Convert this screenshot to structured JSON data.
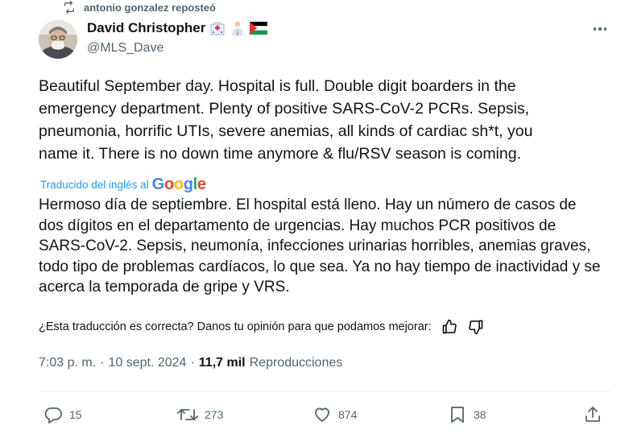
{
  "repost": {
    "label": "antonio gonzalez reposteó"
  },
  "author": {
    "name": "David Christopher",
    "handle": "@MLS_Dave"
  },
  "tweet": {
    "text": "Beautiful September day. Hospital is full. Double digit boarders in the\nemergency department. Plenty of positive SARS-CoV-2 PCRs. Sepsis,\npneumonia, horrific UTIs, severe anemias, all kinds of cardiac sh*t, you\nname it. There is no down time anymore & flu/RSV season is coming.",
    "translated_by": "Traducido del inglés al",
    "translator_brand": "Google",
    "translation": "Hermoso día de septiembre. El hospital está lleno. Hay un número de casos de dos dígitos en el departamento de urgencias. Hay muchos PCR positivos de SARS-CoV-2. Sepsis, neumonía, infecciones urinarias horribles, anemias graves, todo tipo de problemas cardíacos, lo que sea. Ya no hay tiempo de inactividad y se acerca la temporada de gripe y VRS.",
    "feedback_prompt": "¿Esta traducción es correcta? Danos tu opinión para que podamos mejorar:",
    "time": "7:03 p. m.",
    "separator": "·",
    "date": "10 sept. 2024",
    "views_count": "11,7 mil",
    "views_label": "Reproducciones"
  },
  "actions": {
    "replies": "15",
    "reposts": "273",
    "likes": "874",
    "bookmarks": "38"
  },
  "icons": {
    "repost": "repost-icon",
    "more": "more-icon",
    "reply": "reply-icon",
    "like": "heart-icon",
    "bookmark": "bookmark-icon",
    "share": "share-icon",
    "thumbs_up": "thumbs-up-icon",
    "thumbs_down": "thumbs-down-icon",
    "hospital_emoji": "hospital-emoji-icon",
    "health_worker_emoji": "health-worker-emoji-icon",
    "flag_emoji": "palestine-flag-icon"
  },
  "colors": {
    "text": "#0f1419",
    "secondary": "#536471",
    "link": "#1d9bf0"
  }
}
